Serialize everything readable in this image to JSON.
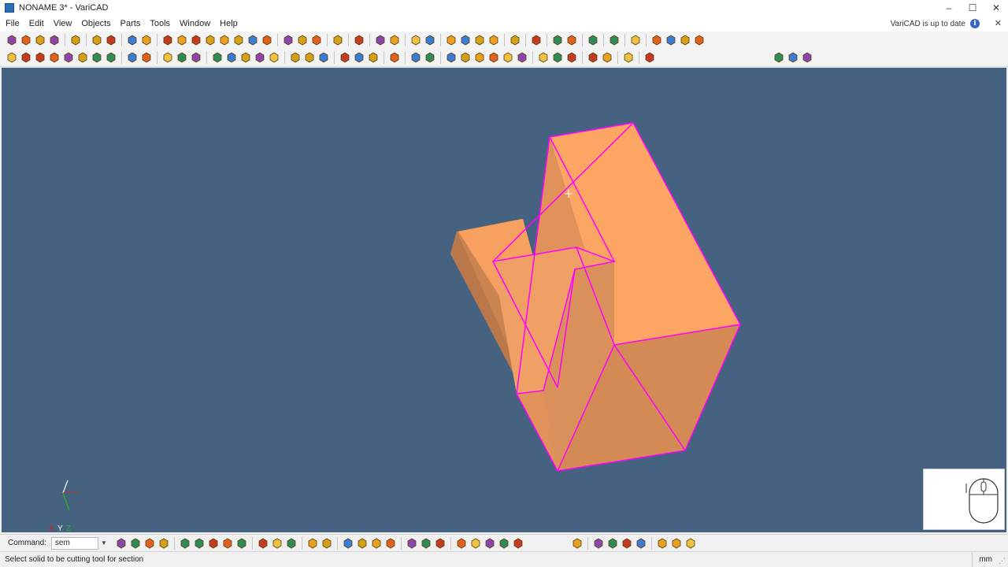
{
  "window": {
    "title": "NONAME 3* - VariCAD",
    "minimize": "–",
    "maximize": "☐",
    "close": "✕"
  },
  "menu": {
    "items": [
      "File",
      "Edit",
      "View",
      "Objects",
      "Parts",
      "Tools",
      "Window",
      "Help"
    ],
    "update_status": "VariCAD is up to date",
    "info_glyph": "i",
    "close_x": "✕"
  },
  "toolbar1_icons": [
    "new-file-icon",
    "open-file-icon",
    "save-icon",
    "save-all-icon",
    "|",
    "print-icon",
    "|",
    "copy-icon",
    "paste-icon",
    "|",
    "undo-icon",
    "redo-icon",
    "|",
    "box-icon",
    "cylinder-icon",
    "cone-icon",
    "sphere-icon",
    "pipe-icon",
    "torus-icon",
    "sweep-icon",
    "revolve-icon",
    "|",
    "view-front-icon",
    "view-top-icon",
    "view-side-icon",
    "|",
    "iso-view-icon",
    "|",
    "sum-icon",
    "|",
    "layer-icon",
    "layer-edit-icon",
    "|",
    "edit-solid-icon",
    "transform-icon",
    "|",
    "measure-icon",
    "measure2-icon",
    "measure3-icon",
    "measure4-icon",
    "|",
    "pencil-icon",
    "|",
    "color-icon",
    "|",
    "zoom-window-icon",
    "zoom-all-icon",
    "|",
    "shading-icon",
    "|",
    "display-icon",
    "|",
    "display2-icon",
    "|",
    "zoom-in-icon",
    "zoom-out-icon",
    "zoom-prev-icon",
    "zoom-fit-icon"
  ],
  "toolbar2_icons": [
    "point-icon",
    "delete-icon",
    "rotate-icon",
    "mirror-icon",
    "array-icon",
    "edge-icon",
    "fillet-icon",
    "chamfer-icon",
    "|",
    "subtract-icon",
    "union-icon",
    "|",
    "color-picker-icon",
    "cut-icon",
    "move-icon",
    "|",
    "slice-icon",
    "wedge-icon",
    "extrude-icon",
    "loft-icon",
    "shell-icon",
    "|",
    "bolt-icon",
    "nut-icon",
    "washer-icon",
    "|",
    "feature1-icon",
    "feature2-icon",
    "feature3-icon",
    "|",
    "group-icon",
    "|",
    "select-icon",
    "snap-icon",
    "|",
    "constraint1-icon",
    "constraint2-icon",
    "constraint3-icon",
    "constraint4-icon",
    "constraint5-icon",
    "constraint6-icon",
    "|",
    "dim-icon",
    "dim2-icon",
    "dim3-icon",
    "|",
    "part-icon",
    "assembly-icon",
    "|",
    "bom-icon",
    "|",
    "settings-icon"
  ],
  "toolbar2_right_icons": [
    "view-2d-icon",
    "view-2d-3d-icon",
    "view-3d-icon"
  ],
  "command": {
    "label": "Command:",
    "value": "sem"
  },
  "command_icons": [
    "solid-box-icon",
    "solid-l-icon",
    "solid-corner-icon",
    "text-icon",
    "|",
    "trim-icon",
    "extend-icon",
    "offset-icon",
    "break-icon",
    "join-icon",
    "|",
    "red-arrow-up-icon",
    "red-arrow-mid-icon",
    "red-arrow-down-icon",
    "|",
    "rotate-cw-icon",
    "rotate-ccw-icon",
    "|",
    "align1-icon",
    "align2-icon",
    "align3-icon",
    "align4-icon",
    "|",
    "hatch1-icon",
    "hatch2-icon",
    "hatch3-icon",
    "|",
    "mod1-icon",
    "mod2-icon",
    "mod3-icon",
    "mod4-icon",
    "mod5-icon"
  ],
  "command_icons_right": [
    "cursor-icon",
    "|",
    "tool1-icon",
    "tool2-icon",
    "tool3-icon",
    "tool4-icon",
    "|",
    "paint-icon",
    "solid-yellow-icon",
    "solid-orange-icon"
  ],
  "axis": {
    "x": "X",
    "y": "Y",
    "z": "Z"
  },
  "status": {
    "message": "Select solid to be cutting tool for section",
    "units": "mm"
  },
  "colors": {
    "viewport_bg": "#456380",
    "solid_face_light": "#fda562",
    "solid_face_mid": "#e0925a",
    "solid_face_dark": "#c98450",
    "highlight_edge": "#ff00ff"
  }
}
